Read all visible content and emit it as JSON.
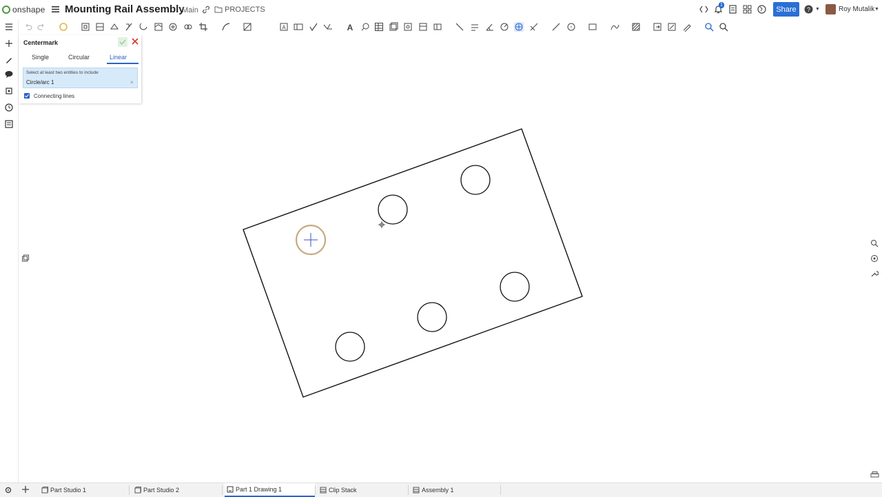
{
  "app": {
    "brand": "onshape",
    "title": "Mounting Rail Assembly",
    "branch": "Main",
    "projects": "PROJECTS"
  },
  "header": {
    "notifications_count": "1",
    "share_label": "Share",
    "user_name": "Roy Mutalik"
  },
  "feature_panel": {
    "title": "Centermark",
    "tabs": [
      "Single",
      "Circular",
      "Linear"
    ],
    "active_tab": "Linear",
    "selection_hint": "Select at least two entities to include",
    "selection_value": "Circle/arc 1",
    "checkbox_label": "Connecting lines",
    "checkbox_checked": true
  },
  "bottom_tabs": [
    {
      "label": "Part Studio 1",
      "icon": "part-studio-icon"
    },
    {
      "label": "Part Studio 2",
      "icon": "part-studio-icon"
    },
    {
      "label": "Part 1 Drawing 1",
      "icon": "drawing-icon",
      "active": true
    },
    {
      "label": "Clip Stack",
      "icon": "assembly-icon"
    },
    {
      "label": "Assembly 1",
      "icon": "assembly-icon"
    }
  ],
  "colors": {
    "accent": "#2b6fd6",
    "highlight_circle": "#c8a882",
    "selection_fill": "#d7eaf9"
  }
}
